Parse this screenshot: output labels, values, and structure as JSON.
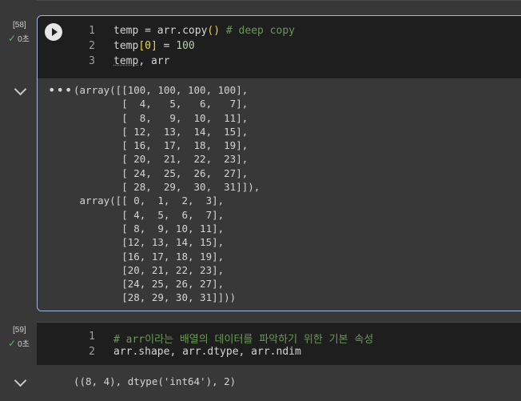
{
  "cells": [
    {
      "exec_count": "[58]",
      "time": "0초",
      "code_lines": [
        {
          "num": "1",
          "parts": {
            "a": "temp = arr.copy",
            "p": "()",
            "c": " # deep copy"
          }
        },
        {
          "num": "2",
          "parts": {
            "a": "temp",
            "p": "[0]",
            "b": " = ",
            "n": "100"
          }
        },
        {
          "num": "3",
          "parts": {
            "a": "temp",
            "b": ", arr"
          }
        }
      ],
      "output": "(array([[100, 100, 100, 100],\n        [  4,   5,   6,   7],\n        [  8,   9,  10,  11],\n        [ 12,  13,  14,  15],\n        [ 16,  17,  18,  19],\n        [ 20,  21,  22,  23],\n        [ 24,  25,  26,  27],\n        [ 28,  29,  30,  31]]),\n array([[ 0,  1,  2,  3],\n        [ 4,  5,  6,  7],\n        [ 8,  9, 10, 11],\n        [12, 13, 14, 15],\n        [16, 17, 18, 19],\n        [20, 21, 22, 23],\n        [24, 25, 26, 27],\n        [28, 29, 30, 31]]))"
    },
    {
      "exec_count": "[59]",
      "time": "0초",
      "code_lines": [
        {
          "num": "1",
          "text": "# arr이라는 배열의 데이터를 파악하기 위한 기본 속성"
        },
        {
          "num": "2",
          "text": "arr.shape, arr.dtype, arr.ndim"
        }
      ],
      "output": "((8, 4), dtype('int64'), 2)"
    }
  ]
}
